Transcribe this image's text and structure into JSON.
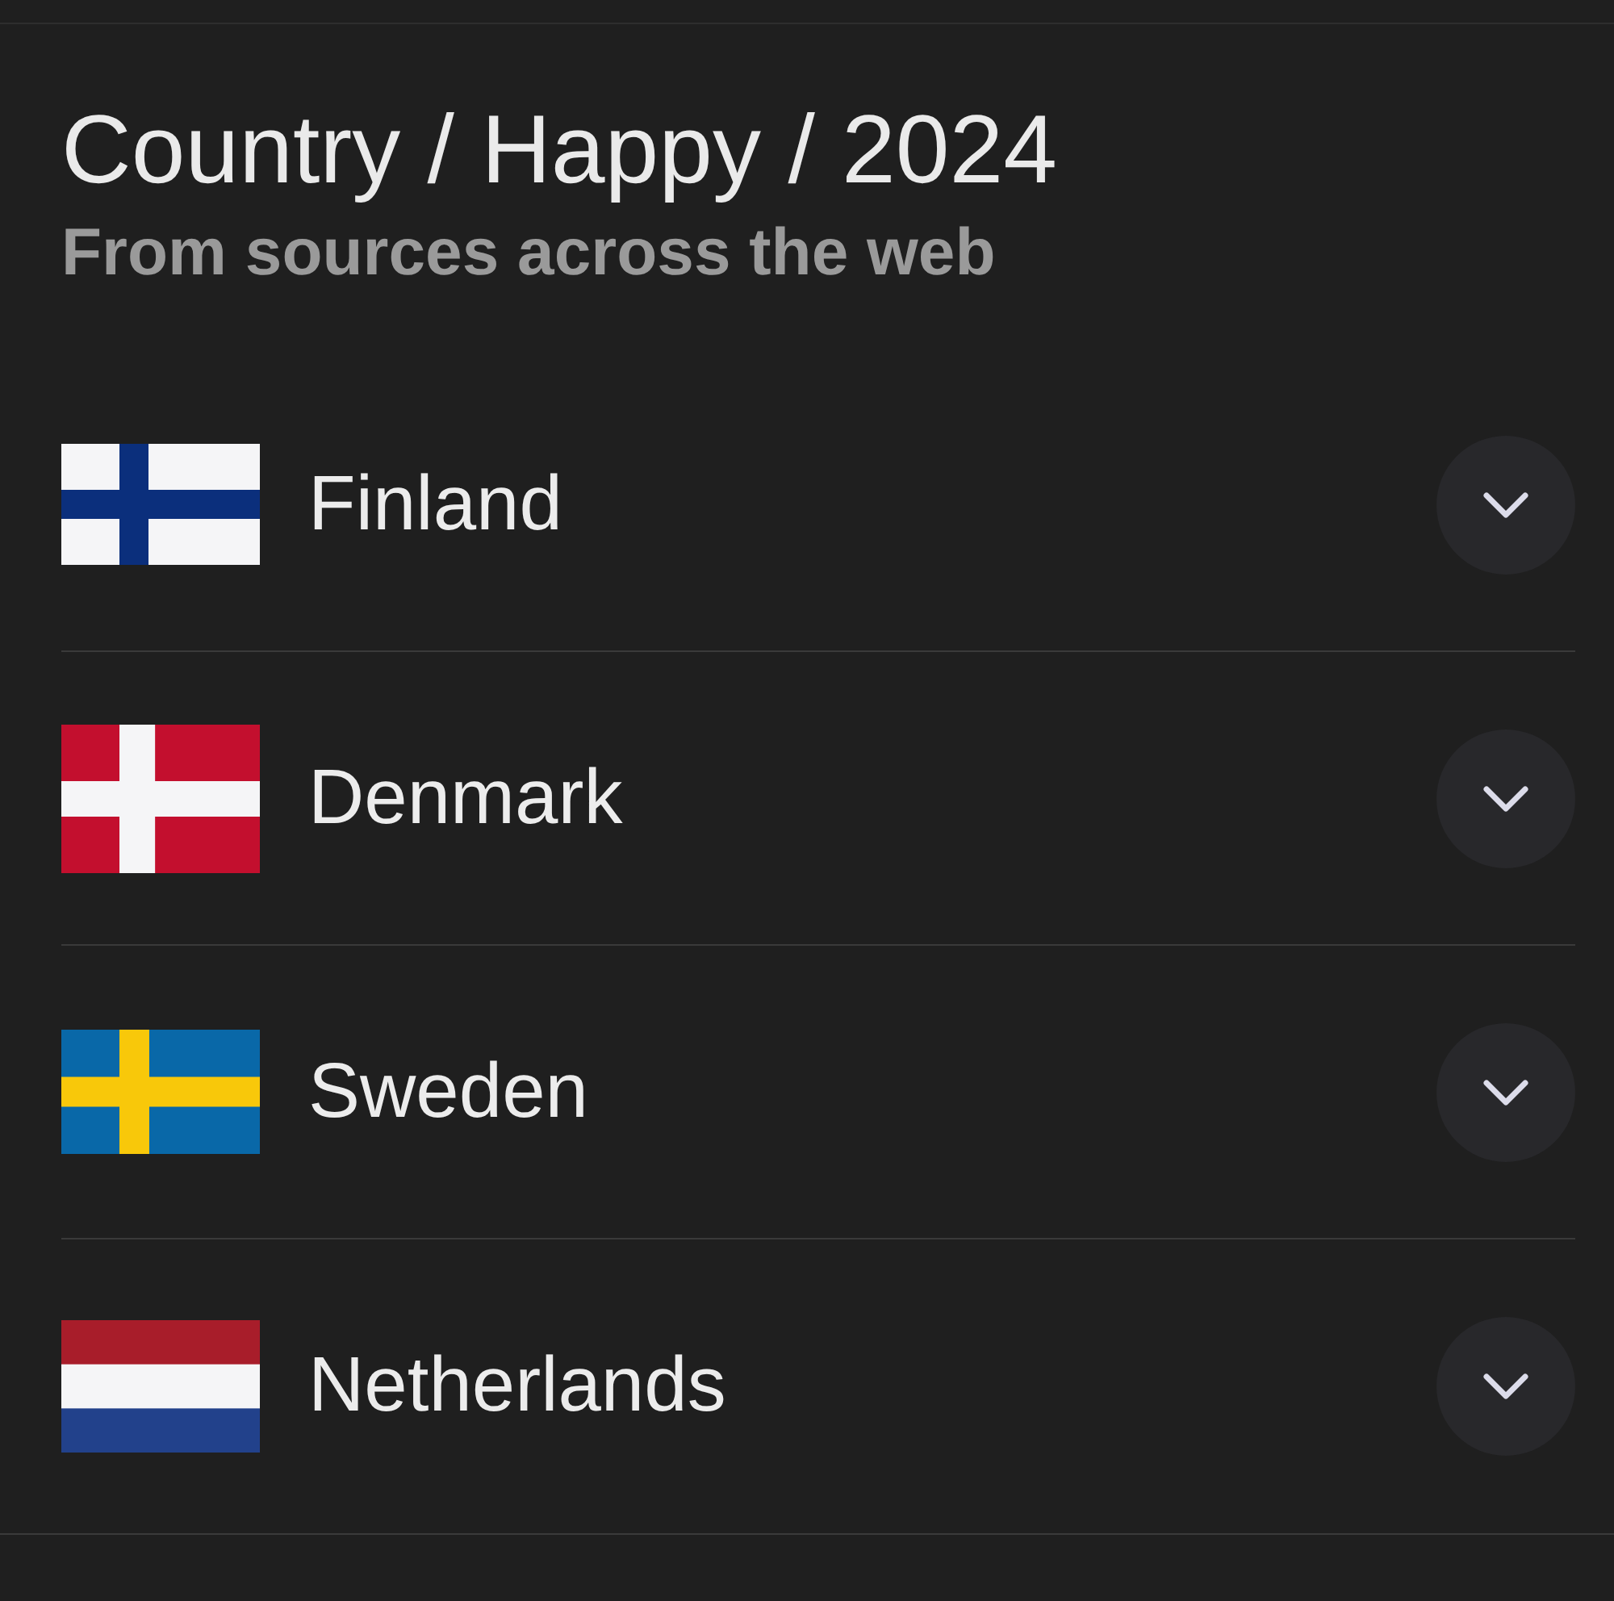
{
  "header": {
    "title": "Country / Happy / 2024",
    "subtitle": "From sources across the web"
  },
  "countries": [
    {
      "name": "Finland",
      "expanded": false,
      "flag": {
        "kind": "cross",
        "parts": [
          {
            "color": "#f5f5f7"
          },
          {
            "color": "#0b2f7c"
          }
        ]
      }
    },
    {
      "name": "Denmark",
      "expanded": false,
      "flag": {
        "kind": "cross",
        "parts": [
          {
            "color": "#c30f2e"
          },
          {
            "color": "#f5f5f7"
          }
        ]
      }
    },
    {
      "name": "Sweden",
      "expanded": false,
      "flag": {
        "kind": "cross",
        "parts": [
          {
            "color": "#0968a8"
          },
          {
            "color": "#f8c80a"
          }
        ]
      }
    },
    {
      "name": "Netherlands",
      "expanded": false,
      "flag": {
        "kind": "tricolor",
        "parts": [
          {
            "color": "#a81d2a"
          },
          {
            "color": "#f5f5f7"
          },
          {
            "color": "#22418b"
          }
        ]
      }
    }
  ]
}
